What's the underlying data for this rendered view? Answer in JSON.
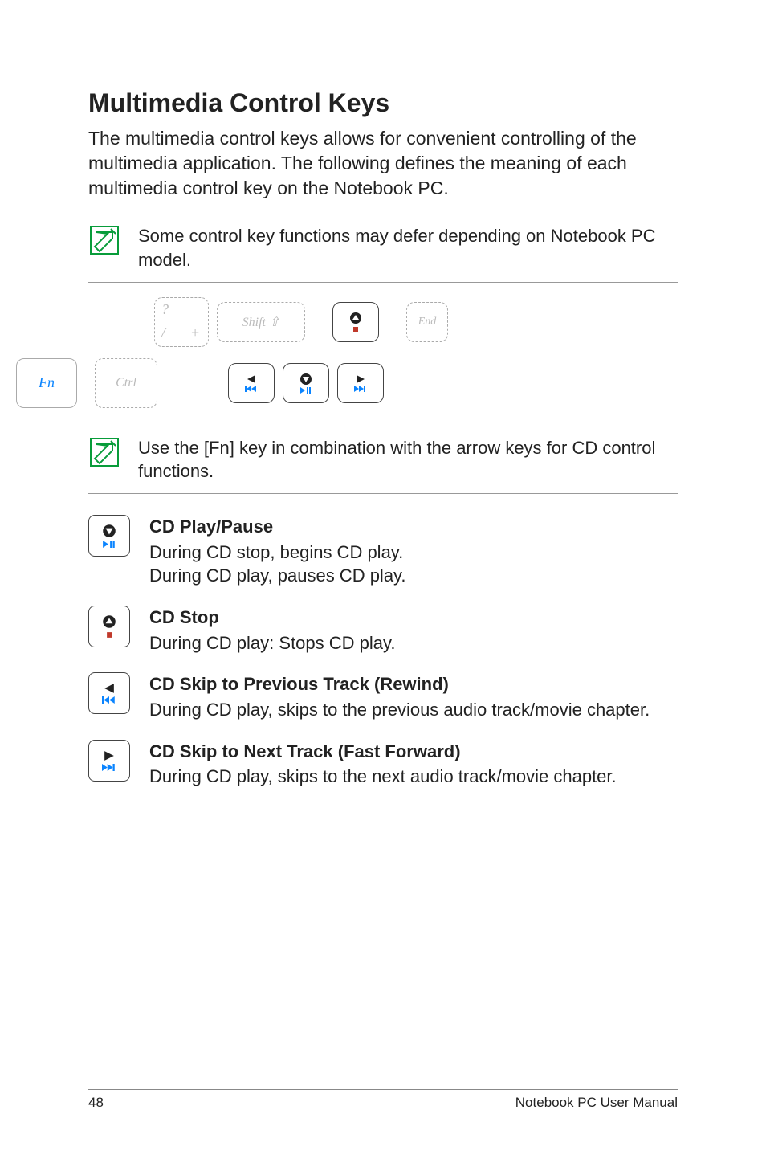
{
  "headings": {
    "title": "Multimedia Control Keys"
  },
  "intro": "The multimedia control keys allows for convenient controlling of the multimedia application. The following defines the meaning of each multimedia control key on the Notebook PC.",
  "notes": {
    "model": "Some control key functions may defer depending on Notebook PC model.",
    "fn": "Use the [Fn] key in combination with the arrow keys for CD control functions."
  },
  "diagram": {
    "fn_label": "Fn",
    "ghost_shift": "Shift ⇧",
    "ghost_ctrl": "Ctrl",
    "ghost_end": "End",
    "ghost_slash_q": "?",
    "ghost_slash": "/",
    "ghost_plus": "+"
  },
  "functions": {
    "play": {
      "title": "CD Play/Pause",
      "line1": "During CD stop, begins CD play.",
      "line2": "During CD play, pauses CD play."
    },
    "stop": {
      "title": "CD Stop",
      "line1": "During CD play: Stops CD play."
    },
    "prev": {
      "title": "CD Skip to Previous Track (Rewind)",
      "line1": "During CD play, skips to the previous audio track/movie chapter."
    },
    "next": {
      "title": "CD Skip to Next Track (Fast Forward)",
      "line1": "During CD play, skips to the next audio track/movie chapter."
    }
  },
  "footer": {
    "page": "48",
    "book": "Notebook PC User Manual"
  }
}
